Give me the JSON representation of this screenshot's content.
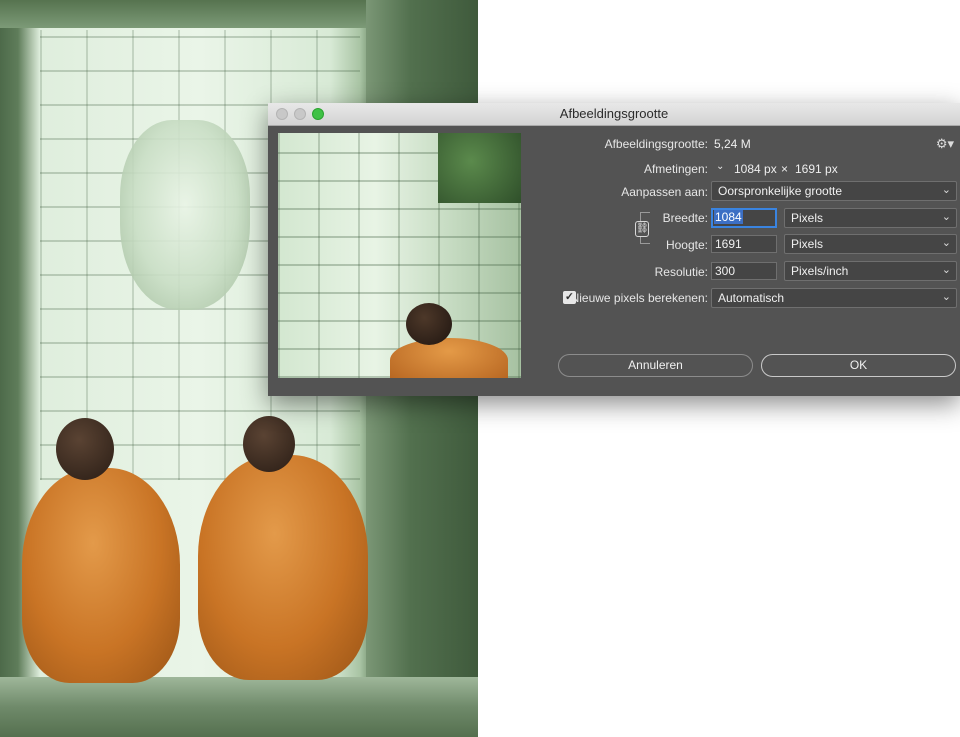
{
  "dialog": {
    "title": "Afbeeldingsgrootte",
    "image_size_label": "Afbeeldingsgrootte:",
    "image_size_value": "5,24 M",
    "dimensions_label": "Afmetingen:",
    "dimensions_width": "1084 px",
    "dimensions_sep": "×",
    "dimensions_height": "1691 px",
    "fit_to_label": "Aanpassen aan:",
    "fit_to_value": "Oorspronkelijke grootte",
    "width_label": "Breedte:",
    "width_value": "1084",
    "width_unit": "Pixels",
    "height_label": "Hoogte:",
    "height_value": "1691",
    "height_unit": "Pixels",
    "resolution_label": "Resolutie:",
    "resolution_value": "300",
    "resolution_unit": "Pixels/inch",
    "resample_label": "Nieuwe pixels berekenen:",
    "resample_checked": true,
    "resample_value": "Automatisch",
    "cancel_label": "Annuleren",
    "ok_label": "OK"
  },
  "icons": {
    "gear": "gear-icon",
    "chain": "link-icon",
    "chevron": "chevron-down-icon",
    "check": "checkmark-icon"
  },
  "colors": {
    "dialog_bg": "#535353",
    "accent": "#3a84e0",
    "robe": "#c97425"
  }
}
